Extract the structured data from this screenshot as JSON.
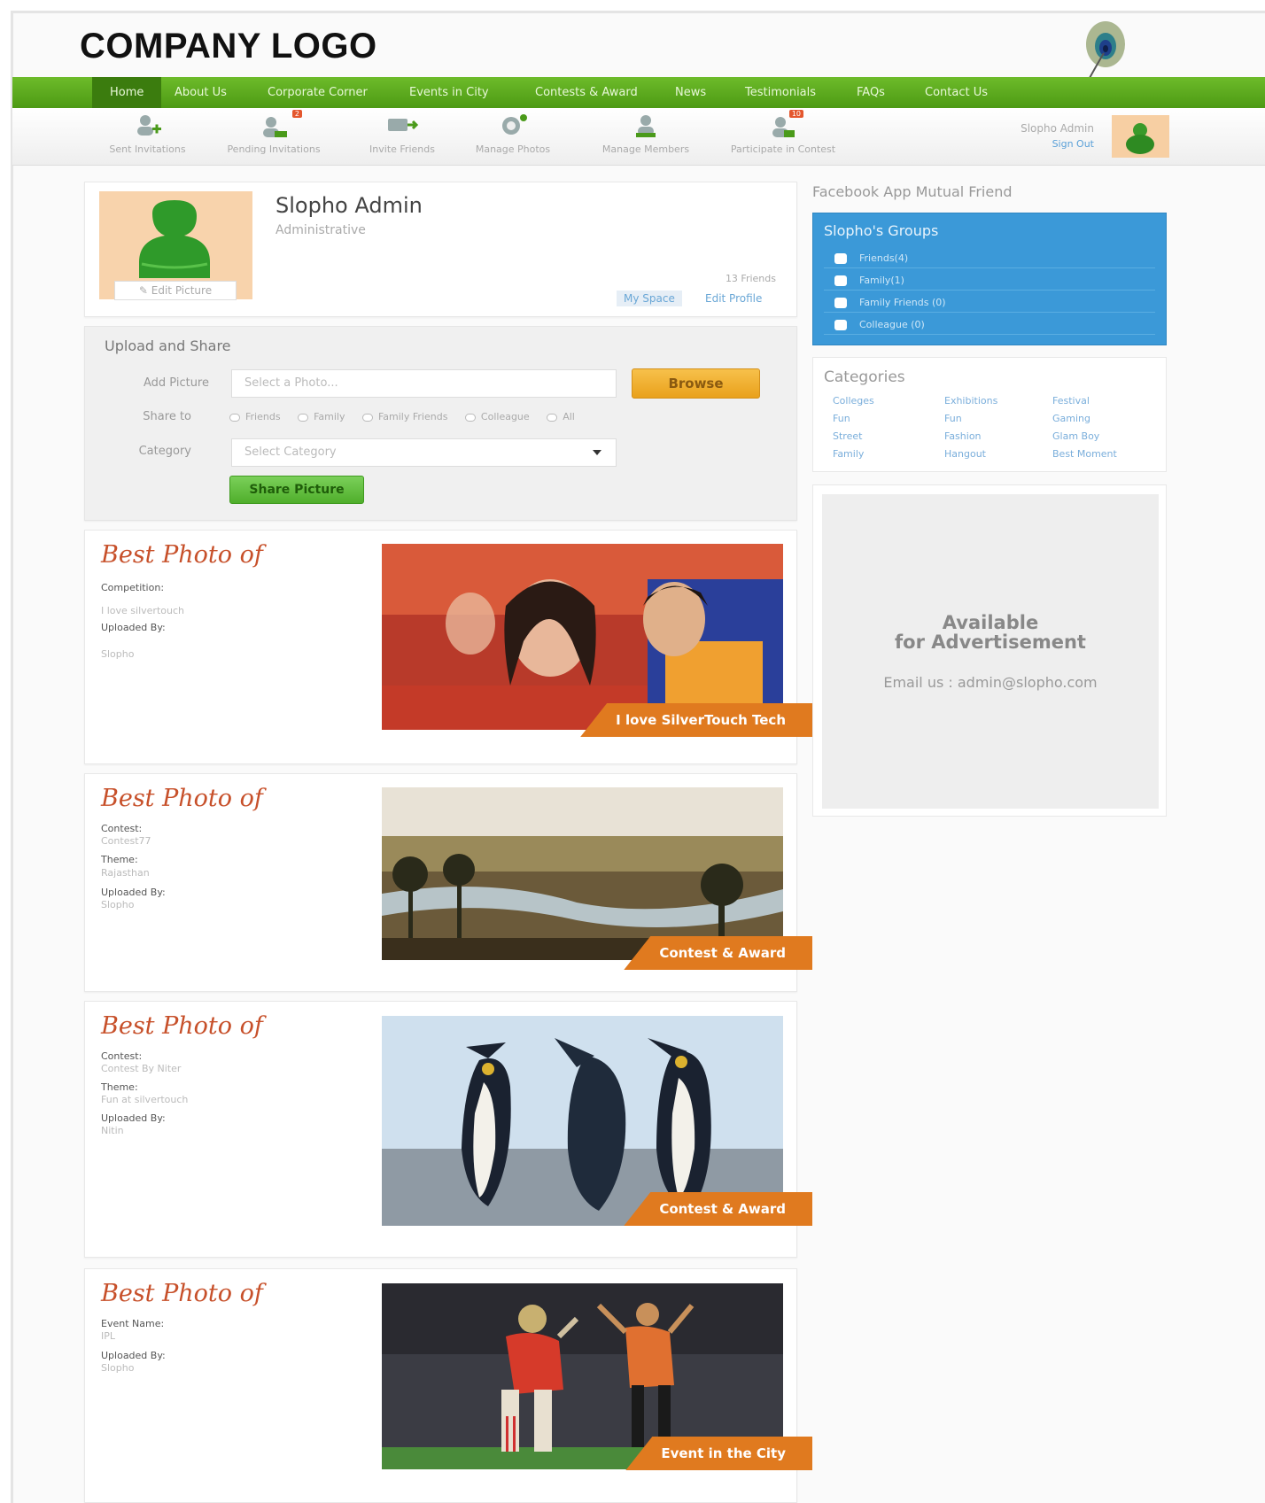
{
  "header": {
    "logo_text": "COMPANY LOGO"
  },
  "nav": {
    "items": [
      "Home",
      "About Us",
      "Corporate Corner",
      "Events in City",
      "Contests & Award",
      "News",
      "Testimonials",
      "FAQs",
      "Contact Us"
    ],
    "active": "Home"
  },
  "toolbar": {
    "items": [
      {
        "label": "Sent Invitations",
        "icon": "user-add-icon"
      },
      {
        "label": "Pending Invitations",
        "icon": "pending-icon",
        "badge": "2"
      },
      {
        "label": "Invite Friends",
        "icon": "invite-icon"
      },
      {
        "label": "Manage Photos",
        "icon": "camera-icon"
      },
      {
        "label": "Manage Members",
        "icon": "members-icon"
      },
      {
        "label": "Participate in Contest",
        "icon": "contest-icon",
        "badge": "10"
      }
    ],
    "user_name": "Slopho Admin",
    "user_link": "Sign Out"
  },
  "profile": {
    "name": "Slopho Admin",
    "role": "Administrative",
    "edit_picture": "Edit Picture",
    "friends": "13 Friends",
    "my_space": "My Space",
    "edit_profile": "Edit Profile"
  },
  "upload": {
    "title": "Upload and Share",
    "add_picture_label": "Add Picture",
    "add_picture_placeholder": "Select a Photo...",
    "browse": "Browse",
    "share_label": "Share to",
    "share_options": [
      "Friends",
      "Family",
      "Family Friends",
      "Colleague",
      "All"
    ],
    "category_label": "Category",
    "category_placeholder": "Select Category",
    "share_button": "Share Picture"
  },
  "posts": [
    {
      "heading": "Best Photo of",
      "fields": [
        {
          "label": "Competition:",
          "value": "I love silvertouch"
        },
        {
          "label": "Uploaded By:",
          "value": "Slopho"
        }
      ],
      "ribbon": "I love SilverTouch Tech"
    },
    {
      "heading": "Best Photo of",
      "fields": [
        {
          "label": "Contest:",
          "value": "Contest77"
        },
        {
          "label": "Theme:",
          "value": "Rajasthan"
        },
        {
          "label": "Uploaded By:",
          "value": "Slopho"
        }
      ],
      "ribbon": "Contest & Award"
    },
    {
      "heading": "Best Photo of",
      "fields": [
        {
          "label": "Contest:",
          "value": "Contest By Niter"
        },
        {
          "label": "Theme:",
          "value": "Fun at silvertouch"
        },
        {
          "label": "Uploaded By:",
          "value": "Nitin"
        }
      ],
      "ribbon": "Contest & Award"
    },
    {
      "heading": "Best Photo of",
      "fields": [
        {
          "label": "Event Name:",
          "value": "IPL"
        },
        {
          "label": "Uploaded By:",
          "value": "Slopho"
        }
      ],
      "ribbon": "Event in the City"
    }
  ],
  "sidebar": {
    "title": "Facebook App Mutual Friend",
    "groups_title": "Slopho's Groups",
    "groups": [
      "Friends(4)",
      "Family(1)",
      "Family Friends (0)",
      "Colleague (0)"
    ],
    "categories_title": "Categories",
    "categories": [
      "Colleges",
      "Exhibitions",
      "Festival",
      "Fun",
      "Fun",
      "Gaming",
      "Street",
      "Fashion",
      "Glam Boy",
      "Family",
      "Hangout",
      "Best Moment"
    ],
    "ad_line1": "Available",
    "ad_line2": "for Advertisement",
    "ad_email": "Email us : admin@slopho.com"
  },
  "colors": {
    "nav_green": "#5aaa1e",
    "groups_blue": "#3b99d8",
    "ribbon_orange": "#e07a1f",
    "browse_orange": "#f0b030"
  }
}
